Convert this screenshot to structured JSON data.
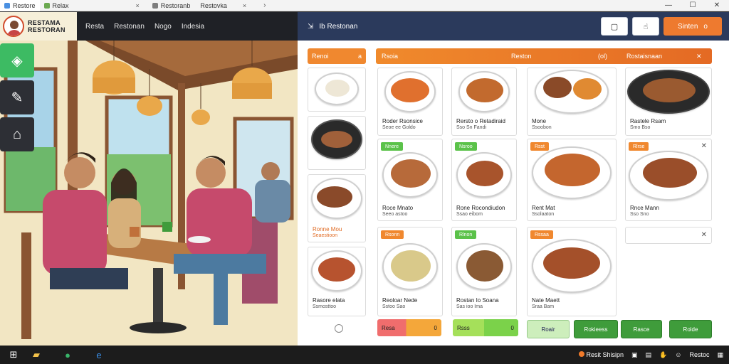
{
  "titlebar": {
    "tabs": [
      {
        "label": "Restore",
        "color": "#4a90e2"
      },
      {
        "label": "Relax",
        "color": "#6aa84f"
      },
      {
        "label": "Restoranb",
        "color": "#7d7d7d"
      },
      {
        "label": "Restovka",
        "color": "#ffffff"
      }
    ],
    "close_glyph": "×",
    "chevron_glyph": "›",
    "window_controls": [
      "—",
      "☐",
      "✕"
    ]
  },
  "brand": {
    "line1": "RESTAMA",
    "line2": "RESTORAN"
  },
  "nav": [
    "Resta",
    "Restonan",
    "Nogo",
    "Indesia"
  ],
  "right_header": {
    "icon": "⇲",
    "title": "Ib Restonan",
    "btn1_glyph": "▢",
    "btn2_glyph": "☝",
    "action_label": "Sinten",
    "action_suffix": "o"
  },
  "rail": [
    {
      "name": "search-tool-icon",
      "glyph": "◈"
    },
    {
      "name": "edit-tool-icon",
      "glyph": "✎"
    },
    {
      "name": "bag-tool-icon",
      "glyph": "⌂"
    }
  ],
  "menu": {
    "side_header": "Renoi",
    "side_header_suffix": "a",
    "main_header_left": "Rsoia",
    "main_header_mid": "Reston",
    "main_header_chip": "(ol)",
    "main_header_right": "Rostaisnaan",
    "main_header_close": "✕",
    "side_cards": [
      {
        "t1": "",
        "t2": ""
      },
      {
        "t1": "",
        "t2": ""
      },
      {
        "t1": "Ronne Mou",
        "t2": "Seaestioon"
      },
      {
        "t1": "Rasore elata",
        "t2": "Ssmosttoo"
      }
    ],
    "grid_cards": [
      {
        "t1": "Roder Rsonsice",
        "t2": "Seoe ee Goldo",
        "badge": ""
      },
      {
        "t1": "Rersto o Retadiraid",
        "t2": "Sso Sn Fandi",
        "badge": ""
      },
      {
        "t1": "Mone",
        "t2": "Ssoobon",
        "badge": ""
      },
      {
        "t1": "Rastele Rsam",
        "t2": "Smo Bso",
        "badge": ""
      },
      {
        "t1": "Roce Mnato",
        "t2": "Seeo astoo",
        "badge": "Nnere"
      },
      {
        "t1": "Rone Rocondiudon",
        "t2": "Ssao eibom",
        "badge": "Nsroo"
      },
      {
        "t1": "Rent Mat",
        "t2": "Ssolaaton",
        "badge": "Rsst"
      },
      {
        "t1": "Rnce Mann",
        "t2": "Sso Sno",
        "badge": "Rlrse"
      },
      {
        "t1": "Reoloar Nede",
        "t2": "Sstoo Sao",
        "badge": "Rsonn"
      },
      {
        "t1": "Rostan Io Soana",
        "t2": "Sas ioo Ima",
        "badge": "Rlnon"
      },
      {
        "t1": "Nate Maett",
        "t2": "Sraa Bam",
        "badge": "Rssaa"
      }
    ],
    "bar_red": {
      "label": "Resa",
      "suffix": "0"
    },
    "bar_green": {
      "label": "Rsss",
      "suffix": "0"
    },
    "buttons": [
      "Roair",
      "Rokieess",
      "Rasce",
      "Rolde"
    ]
  },
  "taskbar": {
    "tray_text": "Resit Shisipn",
    "clock": "Restoc"
  },
  "colors": {
    "accent_orange": "#ee7a2f",
    "accent_green": "#3dbb63",
    "navy": "#2b3a5c"
  }
}
